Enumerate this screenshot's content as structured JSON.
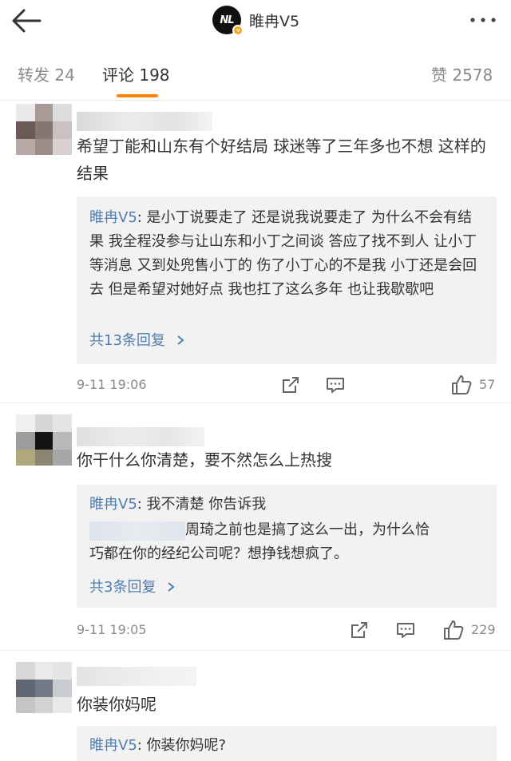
{
  "header": {
    "title": "睢冉V5",
    "logo_text": "NL",
    "verified_mark": "v",
    "back_icon": "back-arrow-icon",
    "more_icon": "more-dots-icon"
  },
  "tabs": {
    "repost": "转发 24",
    "comments": "评论 198",
    "likes": "赞 2578",
    "accent_color": "#ff8200"
  },
  "comments": [
    {
      "text": "希望丁能和山东有个好结局 球迷等了三年多也不想 这样的结果",
      "reply_author": "睢冉V5",
      "reply_text": ": 是小丁说要走了 还是说我说要走了 为什么不会有结果 我全程没参与让山东和小丁之间谈 答应了找不到人 让小丁等消息 又到处兜售小丁的 伤了小丁心的不是我 小丁还是会回去 但是希望对她好点 我也扛了这么多年 也让我歇歇吧",
      "more_replies": "共13条回复",
      "time": "9-11 19:06",
      "likes": "57"
    },
    {
      "text": "你干什么你清楚，要不然怎么上热搜",
      "reply_author": "睢冉V5",
      "reply_text": ": 我不清楚 你告诉我",
      "reply2_text_a": "周琦之前也是搞了这么一出，为什么恰",
      "reply2_text_b": "巧都在你的经纪公司呢？想挣钱想疯了。",
      "more_replies": "共3条回复",
      "time": "9-11 19:05",
      "likes": "229"
    },
    {
      "text": "你装你妈呢",
      "reply_author": "睢冉V5",
      "reply_text": ": 你装你妈呢?"
    }
  ],
  "colors": {
    "link": "#507daf",
    "reply_bg": "#f2f2f2",
    "meta": "#8a8a8a"
  }
}
